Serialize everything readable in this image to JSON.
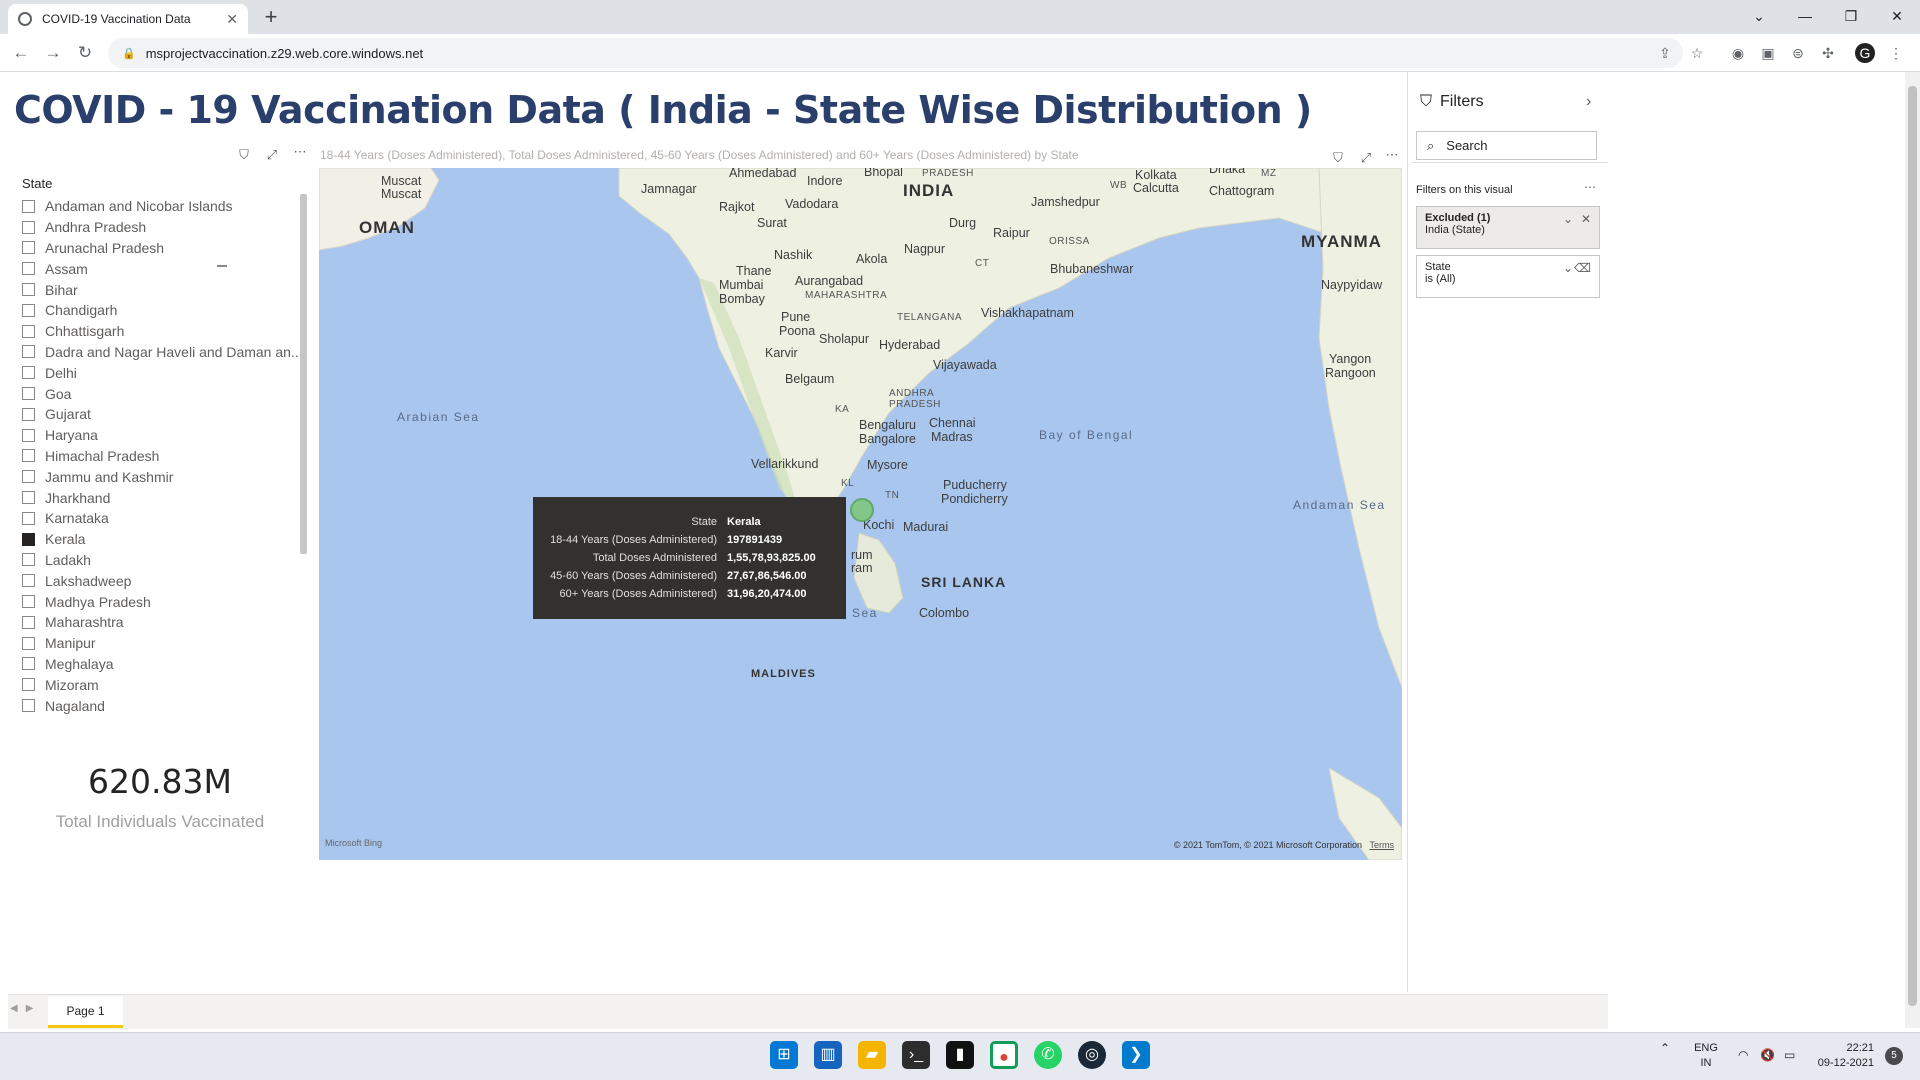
{
  "browser": {
    "tab_title": "COVID-19 Vaccination Data",
    "url": "msprojectvaccination.z29.web.core.windows.net"
  },
  "report": {
    "title": "COVID - 19 Vaccination Data ( India - State Wise Distribution )"
  },
  "slicer": {
    "title": "State",
    "items": [
      {
        "label": "Andaman and Nicobar Islands",
        "checked": false
      },
      {
        "label": "Andhra Pradesh",
        "checked": false
      },
      {
        "label": "Arunachal Pradesh",
        "checked": false
      },
      {
        "label": "Assam",
        "checked": false
      },
      {
        "label": "Bihar",
        "checked": false
      },
      {
        "label": "Chandigarh",
        "checked": false
      },
      {
        "label": "Chhattisgarh",
        "checked": false
      },
      {
        "label": "Dadra and Nagar Haveli and Daman an...",
        "checked": false
      },
      {
        "label": "Delhi",
        "checked": false
      },
      {
        "label": "Goa",
        "checked": false
      },
      {
        "label": "Gujarat",
        "checked": false
      },
      {
        "label": "Haryana",
        "checked": false
      },
      {
        "label": "Himachal Pradesh",
        "checked": false
      },
      {
        "label": "Jammu and Kashmir",
        "checked": false
      },
      {
        "label": "Jharkhand",
        "checked": false
      },
      {
        "label": "Karnataka",
        "checked": false
      },
      {
        "label": "Kerala",
        "checked": true
      },
      {
        "label": "Ladakh",
        "checked": false
      },
      {
        "label": "Lakshadweep",
        "checked": false
      },
      {
        "label": "Madhya Pradesh",
        "checked": false
      },
      {
        "label": "Maharashtra",
        "checked": false
      },
      {
        "label": "Manipur",
        "checked": false
      },
      {
        "label": "Meghalaya",
        "checked": false
      },
      {
        "label": "Mizoram",
        "checked": false
      },
      {
        "label": "Nagaland",
        "checked": false
      }
    ]
  },
  "kpi": {
    "value": "620.83M",
    "label": "Total Individuals Vaccinated"
  },
  "map": {
    "subtitle": "18-44 Years (Doses Administered), Total Doses Administered, 45-60 Years (Doses Administered) and 60+ Years (Doses Administered) by State",
    "attribution_logo": "Microsoft Bing",
    "copyright": "© 2021 TomTom, © 2021 Microsoft Corporation",
    "terms": "Terms",
    "labels": {
      "muscat": "Muscat",
      "oman": "OMAN",
      "jamnagar": "Jamnagar",
      "ahmedabad": "Ahmedabad",
      "indore": "Indore",
      "bhopal": "Bhopal",
      "pradesh": "PRADESH",
      "india": "INDIA",
      "kolkata": "Kolkata",
      "calcutta": "Calcutta",
      "wb": "WB",
      "mz": "MZ",
      "dhaka": "Dhaka",
      "chattogram": "Chattogram",
      "rajkot": "Rajkot",
      "vadodara": "Vadodara",
      "surat": "Surat",
      "jamshedpur": "Jamshedpur",
      "durg": "Durg",
      "raipur": "Raipur",
      "myanmar": "MYANMA",
      "nashik": "Nashik",
      "akola": "Akola",
      "nagpur": "Nagpur",
      "odisha": "ORISSA",
      "ct": "CT",
      "thane": "Thane",
      "mumbai": "Mumbai",
      "bombay": "Bombay",
      "aurangabad": "Aurangabad",
      "maharashtra": "MAHARASHTRA",
      "bhubaneswar": "Bhubaneshwar",
      "naypyidaw": "Naypyidaw",
      "pune": "Pune",
      "poona": "Poona",
      "telangana": "TELANGANA",
      "visakhapatnam": "Vishakhapatnam",
      "sholapur": "Sholapur",
      "hyderabad": "Hyderabad",
      "karvir": "Karvir",
      "vijayawada": "Vijayawada",
      "yangon": "Yangon",
      "rangoon": "Rangoon",
      "belgaum": "Belgaum",
      "andhra": "ANDHRA",
      "ap_pradesh": "PRADESH",
      "ka": "KA",
      "arabian_sea": "Arabian Sea",
      "bengaluru": "Bengaluru",
      "bangalore": "Bangalore",
      "chennai": "Chennai",
      "madras": "Madras",
      "bay_of_bengal": "Bay of Bengal",
      "vellarikkund": "Vellarikkund",
      "mysore": "Mysore",
      "puducherry": "Puducherry",
      "pondicherry": "Pondicherry",
      "kl": "KL",
      "tn": "TN",
      "andaman_sea": "Andaman Sea",
      "kochi": "Kochi",
      "madurai": "Madurai",
      "rum": "rum",
      "ram": "ram",
      "sri_lanka": "SRI LANKA",
      "sea": "Sea",
      "colombo": "Colombo",
      "maldives": "MALDIVES",
      "bhopal_pr": "PRADESH"
    }
  },
  "tooltip": {
    "rows": [
      {
        "key": "State",
        "value": "Kerala"
      },
      {
        "key": "18-44 Years (Doses Administered)",
        "value": "197891439"
      },
      {
        "key": "Total Doses Administered",
        "value": "1,55,78,93,825.00"
      },
      {
        "key": "45-60 Years (Doses Administered)",
        "value": "27,67,86,546.00"
      },
      {
        "key": "60+ Years (Doses Administered)",
        "value": "31,96,20,474.00"
      }
    ]
  },
  "filters": {
    "title": "Filters",
    "search_placeholder": "Search",
    "section": "Filters on this visual",
    "cards": [
      {
        "heading": "Excluded (1)",
        "value": "India (State)"
      },
      {
        "heading": "State",
        "value": "is (All)"
      }
    ]
  },
  "pages": {
    "active": "Page 1"
  },
  "taskbar": {
    "lang_top": "ENG",
    "lang_bottom": "IN",
    "time": "22:21",
    "date": "09-12-2021",
    "notif_count": "5"
  }
}
